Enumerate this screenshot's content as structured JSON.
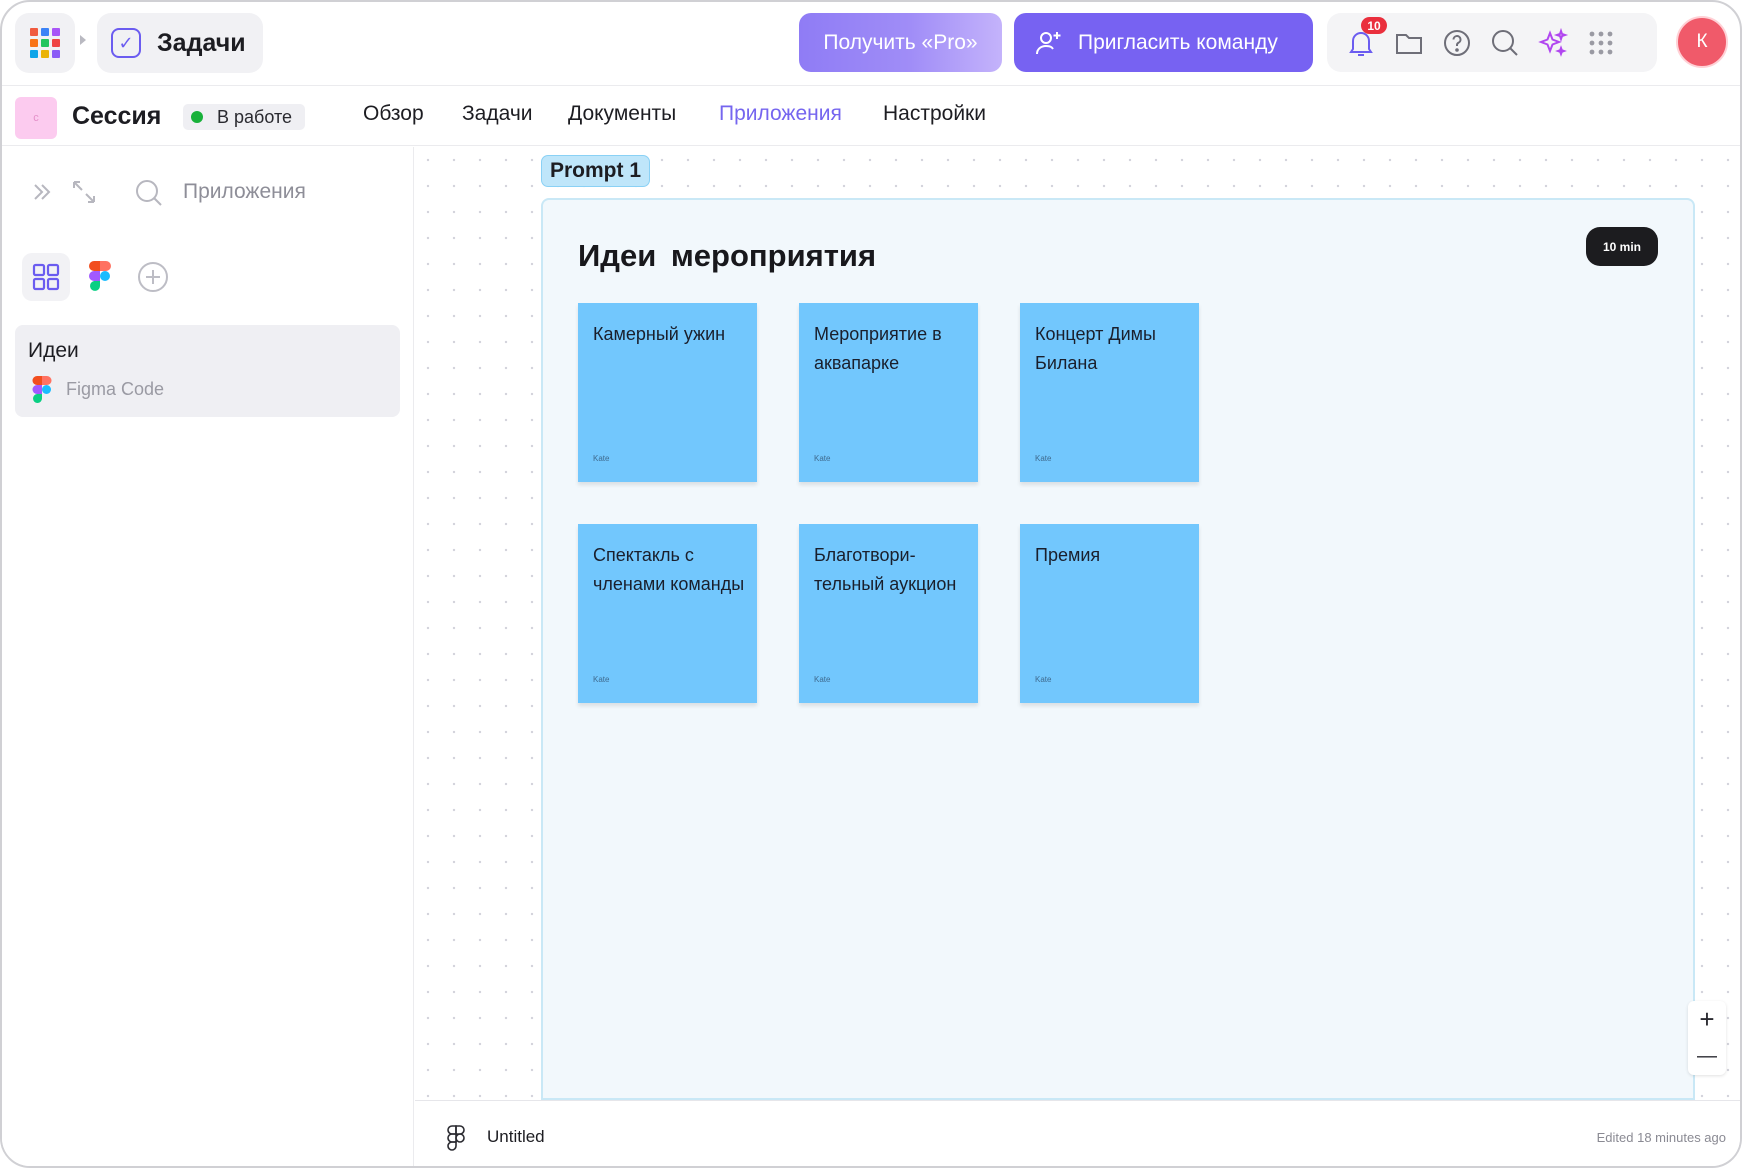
{
  "topbar": {
    "app_name": "Задачи",
    "pro_label": "Получить «Pro»",
    "invite_label": "Пригласить команду",
    "notifications_count": "10",
    "avatar_initial": "К",
    "app_grid_colors": [
      "#f0503e",
      "#3b82f6",
      "#a855f7",
      "#f97316",
      "#22c55e",
      "#ef4444",
      "#0ea5e9",
      "#eab308",
      "#8b5cf6"
    ]
  },
  "project": {
    "icon_letter": "с",
    "title": "Сессия",
    "status": "В работе",
    "status_color": "#18b13a"
  },
  "nav": {
    "overview": "Обзор",
    "tasks": "Задачи",
    "documents": "Документы",
    "apps": "Приложения",
    "settings": "Настройки",
    "active": "apps"
  },
  "sidebar": {
    "search_label": "Приложения",
    "items": [
      {
        "title": "Идеи",
        "subtitle": "Figma Code"
      }
    ]
  },
  "canvas": {
    "prompt_tag": "Prompt 1",
    "frame_title": "Идеи мероприятия",
    "timer": "10 min",
    "stickies": [
      {
        "text": "Камерный ужин",
        "author": "Kate"
      },
      {
        "text": "Мероприятие в аквапарке",
        "author": "Kate"
      },
      {
        "text": "Концерт Димы Билана",
        "author": "Kate"
      },
      {
        "text": "Спектакль с членами команды",
        "author": "Kate"
      },
      {
        "text": "Благотвори-тельный аукцион",
        "author": "Kate"
      },
      {
        "text": "Премия",
        "author": "Kate"
      }
    ],
    "sticky_color": "#72c7fd",
    "zoom_in": "+",
    "zoom_out": "—"
  },
  "footer": {
    "file_name": "Untitled",
    "edited": "Edited 18 minutes ago"
  },
  "accent": "#7762f2"
}
